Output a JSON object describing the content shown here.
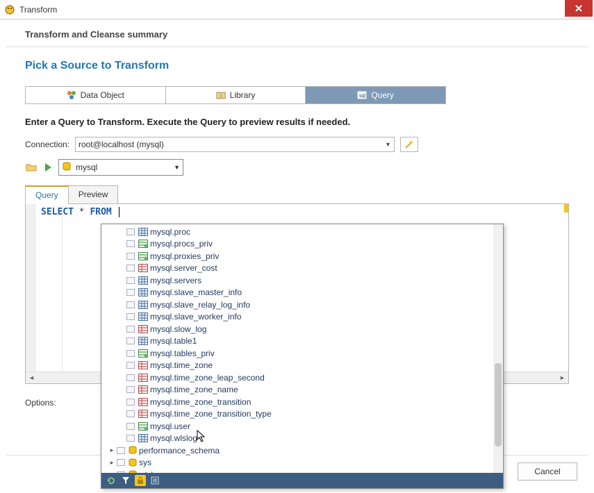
{
  "window": {
    "title": "Transform"
  },
  "summary_label": "Transform and Cleanse summary",
  "section_heading": "Pick a Source to Transform",
  "tabs": {
    "data_object": "Data Object",
    "library": "Library",
    "query": "Query"
  },
  "instruction": "Enter a Query to Transform.  Execute the Query to preview results if needed.",
  "connection": {
    "label": "Connection:",
    "value": "root@localhost (mysql)"
  },
  "db_selector": {
    "value": "mysql"
  },
  "inner_tabs": {
    "query": "Query",
    "preview": "Preview"
  },
  "editor": {
    "kw_select": "SELECT",
    "star": " * ",
    "kw_from": "FROM",
    "tail": " "
  },
  "options_label": "Options:",
  "footer": {
    "cancel": "Cancel"
  },
  "popup": {
    "items": [
      {
        "label": "mysql.proc",
        "icon": "table"
      },
      {
        "label": "mysql.procs_priv",
        "icon": "priv"
      },
      {
        "label": "mysql.proxies_priv",
        "icon": "priv"
      },
      {
        "label": "mysql.server_cost",
        "icon": "sys"
      },
      {
        "label": "mysql.servers",
        "icon": "table"
      },
      {
        "label": "mysql.slave_master_info",
        "icon": "table"
      },
      {
        "label": "mysql.slave_relay_log_info",
        "icon": "table"
      },
      {
        "label": "mysql.slave_worker_info",
        "icon": "table"
      },
      {
        "label": "mysql.slow_log",
        "icon": "sys"
      },
      {
        "label": "mysql.table1",
        "icon": "table"
      },
      {
        "label": "mysql.tables_priv",
        "icon": "priv"
      },
      {
        "label": "mysql.time_zone",
        "icon": "sys"
      },
      {
        "label": "mysql.time_zone_leap_second",
        "icon": "sys"
      },
      {
        "label": "mysql.time_zone_name",
        "icon": "sys"
      },
      {
        "label": "mysql.time_zone_transition",
        "icon": "sys"
      },
      {
        "label": "mysql.time_zone_transition_type",
        "icon": "sys"
      },
      {
        "label": "mysql.user",
        "icon": "priv"
      },
      {
        "label": "mysql.wlslog",
        "icon": "table"
      }
    ],
    "schemas": [
      {
        "label": "performance_schema"
      },
      {
        "label": "sys"
      },
      {
        "label": "wlslog"
      }
    ]
  }
}
